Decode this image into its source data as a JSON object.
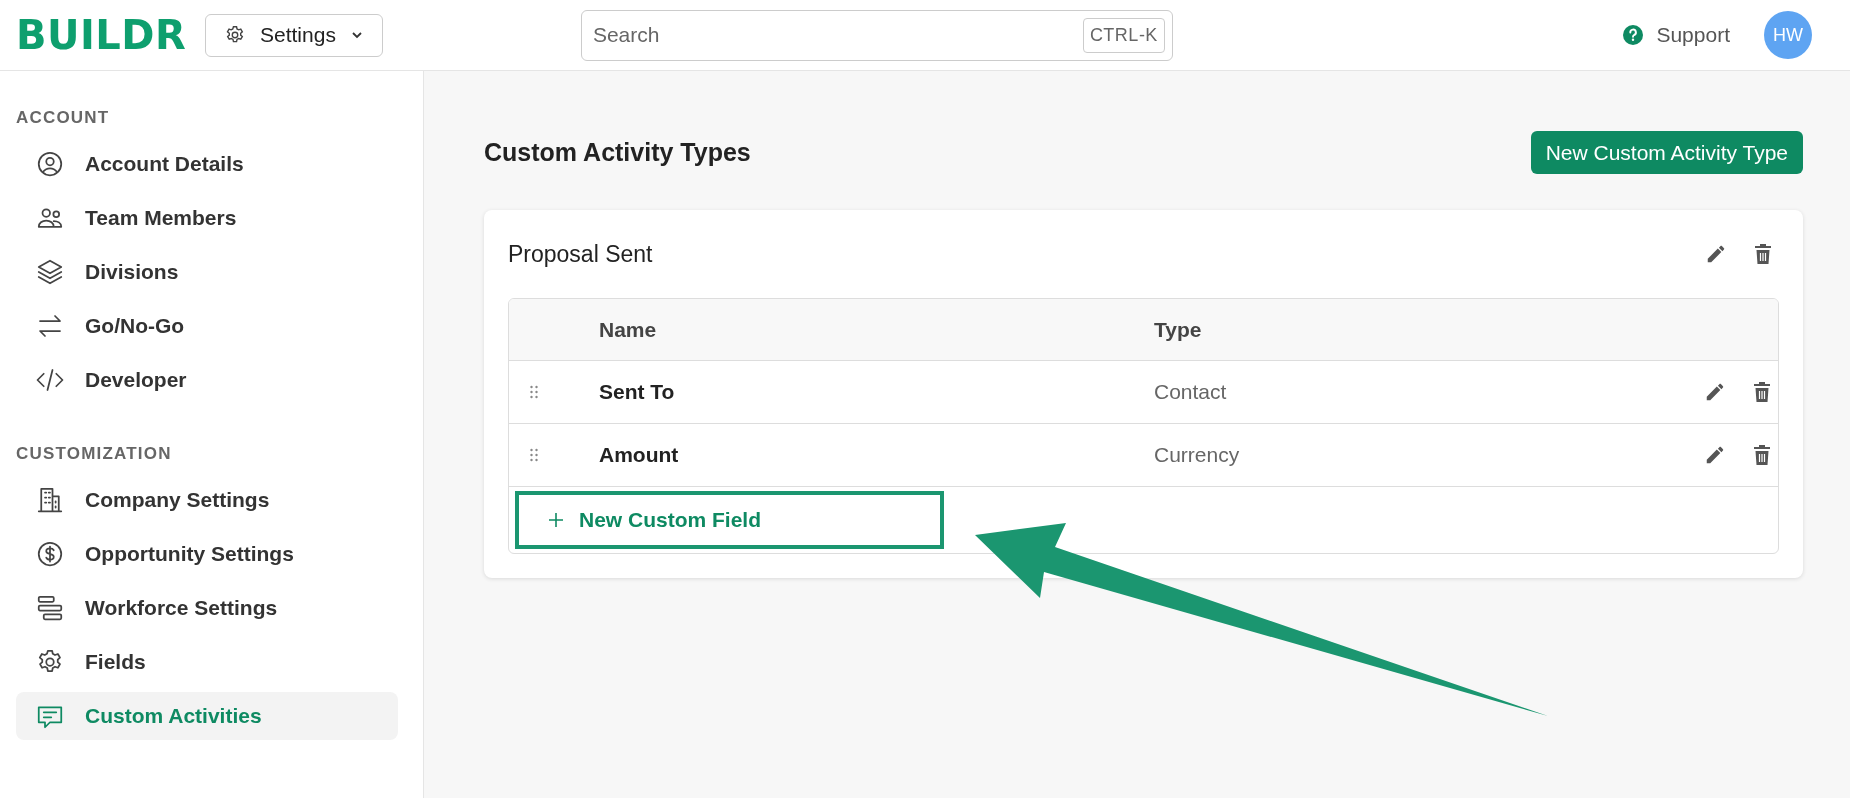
{
  "brand": "BUILDR",
  "settings_menu": {
    "label": "Settings"
  },
  "search": {
    "placeholder": "Search",
    "shortcut": "CTRL-K"
  },
  "support": "Support",
  "avatar": "HW",
  "sidebar": [
    {
      "heading": "ACCOUNT",
      "items": [
        {
          "label": "Account Details",
          "selected": false
        },
        {
          "label": "Team Members",
          "selected": false
        },
        {
          "label": "Divisions",
          "selected": false
        },
        {
          "label": "Go/No-Go",
          "selected": false
        },
        {
          "label": "Developer",
          "selected": false
        }
      ]
    },
    {
      "heading": "CUSTOMIZATION",
      "items": [
        {
          "label": "Company Settings",
          "selected": false
        },
        {
          "label": "Opportunity Settings",
          "selected": false
        },
        {
          "label": "Workforce Settings",
          "selected": false
        },
        {
          "label": "Fields",
          "selected": false
        },
        {
          "label": "Custom Activities",
          "selected": true
        }
      ]
    }
  ],
  "page_title": "Custom Activity Types",
  "primary_button": "New Custom Activity Type",
  "card": {
    "title": "Proposal Sent",
    "table": {
      "columns": [
        "Name",
        "Type"
      ],
      "rows": [
        {
          "name": "Sent To",
          "type": "Contact"
        },
        {
          "name": "Amount",
          "type": "Currency"
        }
      ]
    },
    "add_button": "New Custom Field"
  }
}
